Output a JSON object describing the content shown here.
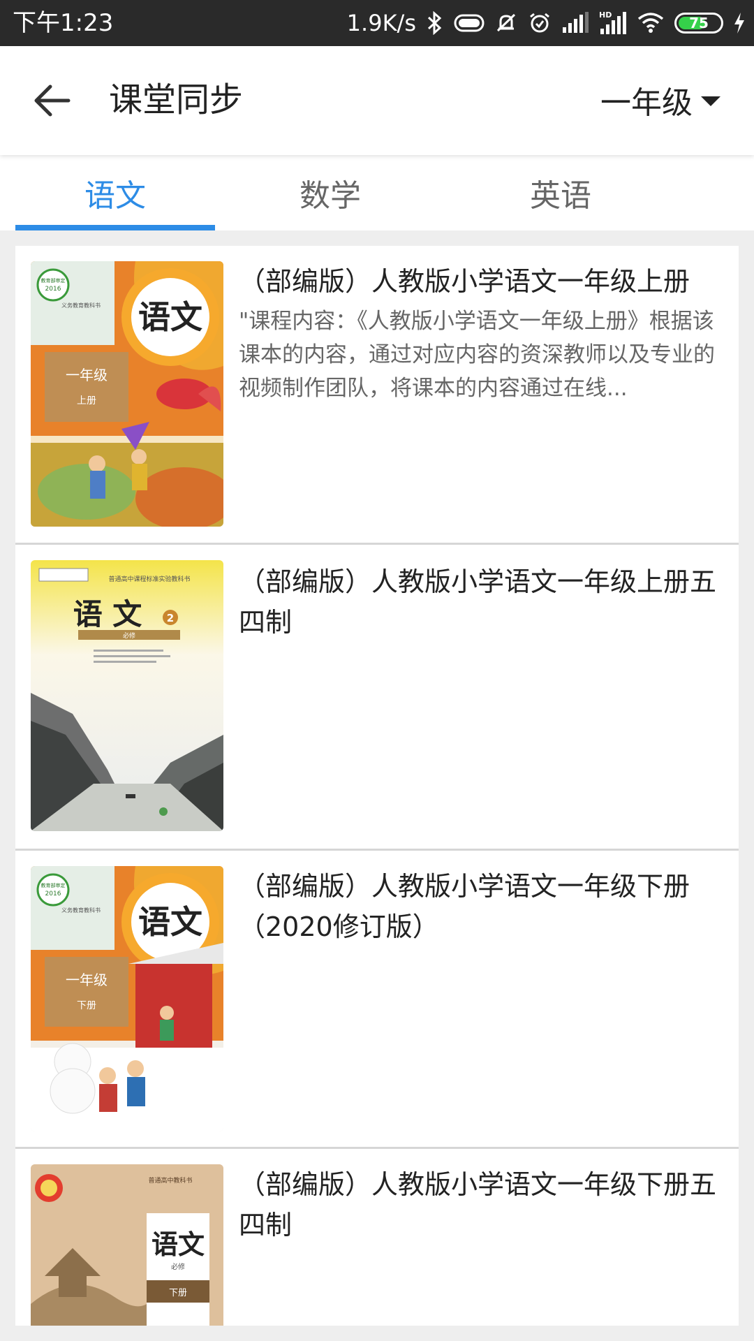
{
  "status_bar": {
    "time": "下午1:23",
    "net_speed": "1.9K/s",
    "battery": "75",
    "battery_color": "#35d14a"
  },
  "header": {
    "title": "课堂同步",
    "grade": "一年级",
    "back_icon": "arrow-left-icon"
  },
  "tabs": [
    {
      "label": "语文",
      "active": true
    },
    {
      "label": "数学",
      "active": false
    },
    {
      "label": "英语",
      "active": false
    }
  ],
  "accent_color": "#2d8ce6",
  "books": [
    {
      "title": "（部编版）人教版小学语文一年级上册",
      "description": "\"课程内容：《人教版小学语文一年级上册》根据该课本的内容，通过对应内容的资深教师以及专业的视频制作团队，将课本的内容通过在线...",
      "cover": {
        "subject": "语文",
        "grade": "一年级",
        "volume": "上册",
        "series": "义务教育教科书",
        "badge": "2016",
        "badge_top": "教育部审定"
      }
    },
    {
      "title": "（部编版）人教版小学语文一年级上册五四制",
      "description": "",
      "cover": {
        "subject": "语 文",
        "volume_no": "2",
        "note": "必修",
        "series": "普通高中课程标准实验教科书"
      }
    },
    {
      "title": "（部编版）人教版小学语文一年级下册（2020修订版）",
      "description": "",
      "cover": {
        "subject": "语文",
        "grade": "一年级",
        "volume": "下册",
        "series": "义务教育教科书",
        "badge": "2016",
        "badge_top": "教育部审定"
      }
    },
    {
      "title": "（部编版）人教版小学语文一年级下册五四制",
      "description": "",
      "cover": {
        "subject": "语文",
        "note": "必修",
        "volume": "下册",
        "series": "普通高中教科书"
      }
    }
  ]
}
